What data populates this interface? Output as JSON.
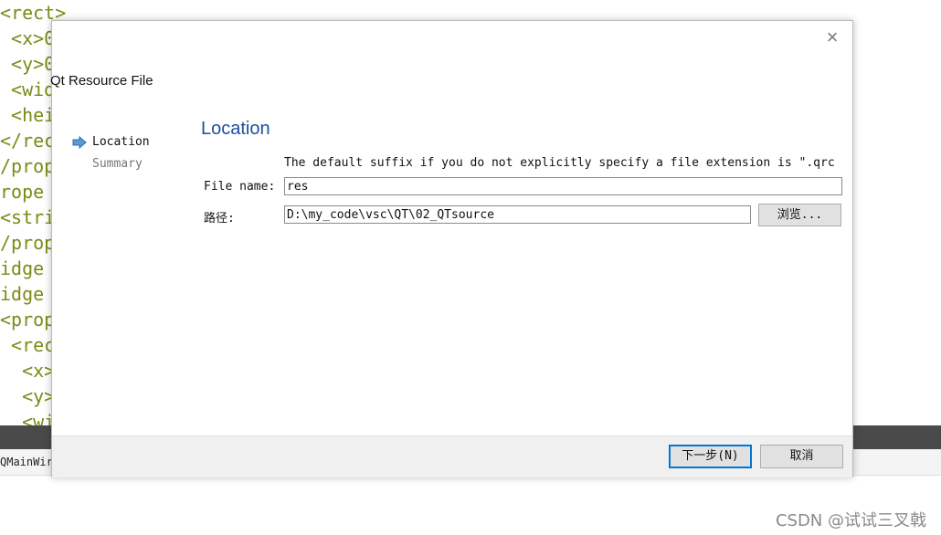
{
  "editor": {
    "lines": [
      "<rect>",
      " <x>0",
      " <y>0",
      " <wid",
      " <hei",
      "</rec",
      "/prop",
      "rope",
      "<stri",
      "/prop",
      "idge",
      "idge",
      "<prop",
      " <rec",
      "  <x>",
      "  <y>",
      "  <wi"
    ]
  },
  "bottom_tab": {
    "label": "QMainWir"
  },
  "watermark": {
    "text": "CSDN @试试三叉戟"
  },
  "dialog": {
    "title": "Qt Resource File",
    "close_glyph": "×",
    "steps": [
      {
        "label": "Location",
        "current": true
      },
      {
        "label": "Summary",
        "current": false
      }
    ],
    "page_heading": "Location",
    "hint": "The default suffix if you do not explicitly specify a file extension is \".qrc",
    "file_name": {
      "label": "File name:",
      "value": "res"
    },
    "path": {
      "label": "路径:",
      "value": "D:\\my_code\\vsc\\QT\\02_QTsource",
      "browse_label": "浏览..."
    },
    "buttons": {
      "next": "下一步(N)",
      "cancel": "取消"
    }
  },
  "colors": {
    "accent": "#1f4f9e",
    "code_text": "#7d8a17",
    "focus_border": "#0078d7"
  }
}
